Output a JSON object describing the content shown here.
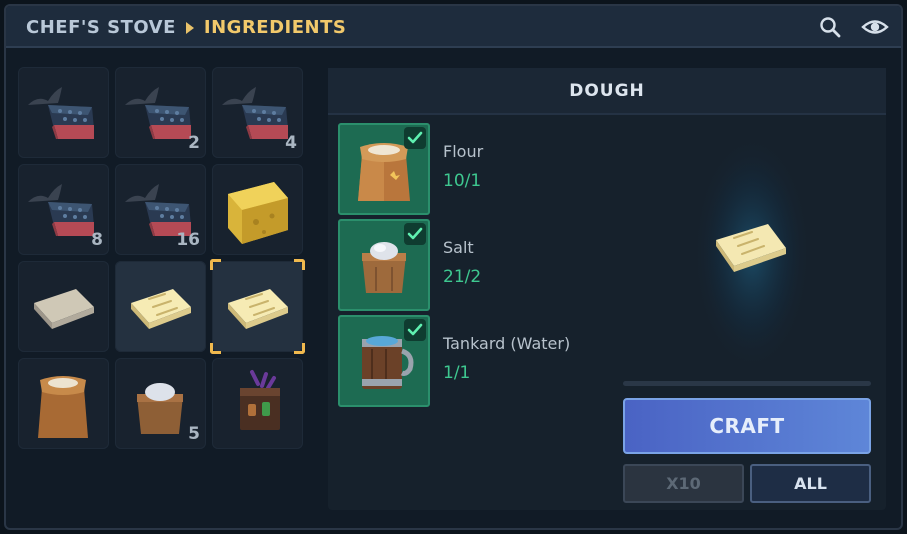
{
  "header": {
    "root_label": "CHEF'S STOVE",
    "current_label": "INGREDIENTS",
    "icons": [
      "search-icon",
      "eye-icon"
    ]
  },
  "inventory": {
    "slots": [
      {
        "item": "raw-fish-meat",
        "count": ""
      },
      {
        "item": "raw-fish-meat",
        "count": "2"
      },
      {
        "item": "raw-fish-meat",
        "count": "4"
      },
      {
        "item": "raw-fish-meat",
        "count": "8"
      },
      {
        "item": "raw-fish-meat",
        "count": "16"
      },
      {
        "item": "cheese-wedge",
        "count": ""
      },
      {
        "item": "raw-dough",
        "count": ""
      },
      {
        "item": "dough",
        "count": ""
      },
      {
        "item": "dough",
        "count": "",
        "selected": true
      },
      {
        "item": "flour-sack",
        "count": ""
      },
      {
        "item": "salt-box",
        "count": "5"
      },
      {
        "item": "potion-crate",
        "count": ""
      }
    ]
  },
  "recipe": {
    "title": "DOUGH",
    "ingredients": [
      {
        "name": "Flour",
        "qty": "10/1",
        "icon": "flour-sack-icon",
        "satisfied": true
      },
      {
        "name": "Salt",
        "qty": "21/2",
        "icon": "salt-box-icon",
        "satisfied": true
      },
      {
        "name": "Tankard (Water)",
        "qty": "1/1",
        "icon": "water-tankard-icon",
        "satisfied": true
      }
    ],
    "preview_icon": "dough-icon",
    "craft_progress": 0,
    "craft_label": "CRAFT",
    "x10_label": "X10",
    "all_label": "ALL"
  },
  "colors": {
    "accent_gold": "#f2c96b",
    "satisfied_green": "#3ec890",
    "craft_blue": "#5e86d8"
  }
}
